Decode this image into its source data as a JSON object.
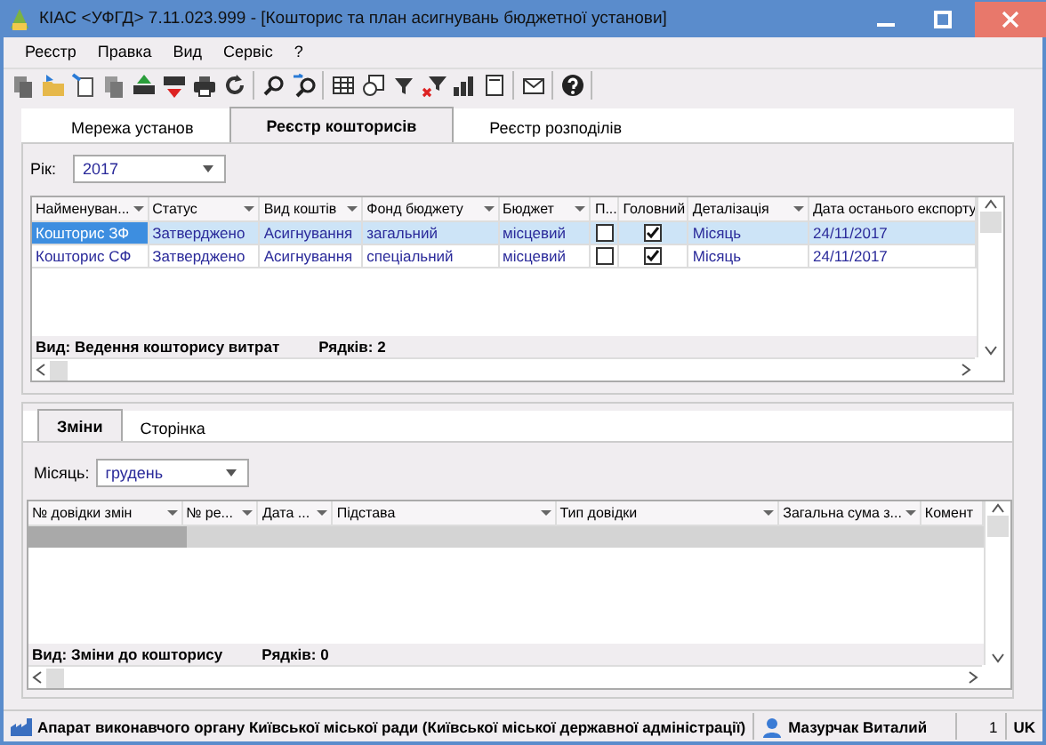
{
  "window": {
    "title": "КІАС <УФГД> 7.11.023.999 - [Кошторис та  план асигнувань бюджетної установи]"
  },
  "menu": [
    "Реєстр",
    "Правка",
    "Вид",
    "Сервіс",
    "?"
  ],
  "tabs": [
    {
      "label": "Мережа установ",
      "selected": false
    },
    {
      "label": "Реєстр кошторисів",
      "selected": true
    },
    {
      "label": "Реєстр розподілів",
      "selected": false
    }
  ],
  "year": {
    "label": "Рік:",
    "value": "2017"
  },
  "estimates": {
    "columns": [
      {
        "label": "Найменуван...",
        "filter": true
      },
      {
        "label": "Статус",
        "filter": true
      },
      {
        "label": "Вид коштів",
        "filter": true
      },
      {
        "label": "Фонд бюджету",
        "filter": true
      },
      {
        "label": "Бюджет",
        "filter": true
      },
      {
        "label": "П...",
        "filter": false
      },
      {
        "label": "Головний",
        "filter": false
      },
      {
        "label": "Деталізація",
        "filter": true
      },
      {
        "label": "Дата останього експорту",
        "filter": false
      }
    ],
    "rows": [
      {
        "selected": true,
        "cells": [
          "Кошторис ЗФ",
          "Затверджено",
          "Асигнування",
          "загальний",
          "місцевий",
          {
            "checked": false
          },
          {
            "checked": true
          },
          "Місяць",
          "24/11/2017"
        ]
      },
      {
        "selected": false,
        "cells": [
          "Кошторис СФ",
          "Затверджено",
          "Асигнування",
          "спеціальний",
          "місцевий",
          {
            "checked": false
          },
          {
            "checked": true
          },
          "Місяць",
          "24/11/2017"
        ]
      }
    ],
    "view": "Вид: Ведення кошторису витрат",
    "count": "Рядків: 2"
  },
  "lower_tabs": [
    {
      "label": "Зміни",
      "selected": true
    },
    {
      "label": "Сторінка",
      "selected": false
    }
  ],
  "month": {
    "label": "Місяць:",
    "value": "грудень"
  },
  "changes": {
    "columns": [
      {
        "label": "№ довідки змін",
        "filter": true
      },
      {
        "label": "№ ре...",
        "filter": true
      },
      {
        "label": "Дата ...",
        "filter": true
      },
      {
        "label": "Підстава",
        "filter": true
      },
      {
        "label": "Тип довідки",
        "filter": true
      },
      {
        "label": "Загальна сума з...",
        "filter": true
      },
      {
        "label": "Комент",
        "filter": false
      }
    ],
    "view": "Вид: Зміни до кошторису",
    "count": "Рядків: 0"
  },
  "status_bar": {
    "organization": "Апарат виконавчого органу Київської міської ради (Київської міської державної адміністрації)",
    "user": "Мазурчак Виталий",
    "page": "1",
    "language": "UK"
  }
}
